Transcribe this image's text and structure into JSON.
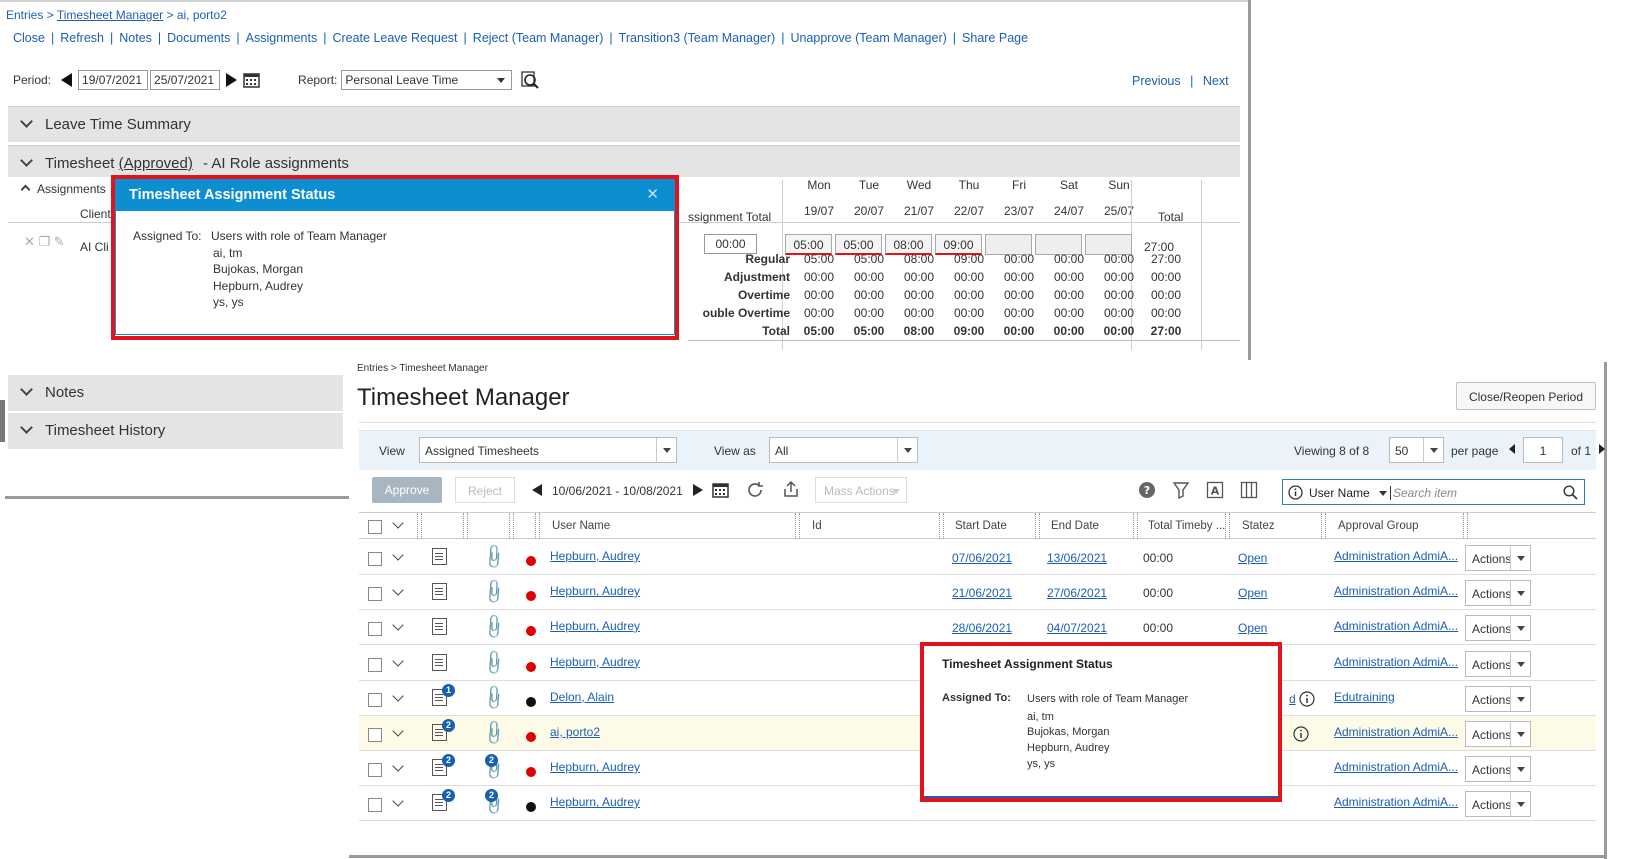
{
  "breadcrumb": {
    "entries": "Entries",
    "sep": ">",
    "manager": "Timesheet Manager",
    "current": "ai, porto2"
  },
  "actions": [
    "Close",
    "Refresh",
    "Notes",
    "Documents",
    "Assignments",
    "Create Leave Request",
    "Reject (Team Manager)",
    "Transition3 (Team Manager)",
    "Unapprove (Team Manager)",
    "Share Page"
  ],
  "period": {
    "label": "Period:",
    "start": "19/07/2021",
    "end": "25/07/2021",
    "report_label": "Report:",
    "report_value": "Personal Leave Time"
  },
  "pager": {
    "previous": "Previous",
    "next": "Next",
    "sep": "|"
  },
  "sections": {
    "leave_summary": "Leave Time Summary",
    "timesheet_prefix": "Timesheet",
    "timesheet_status": "(Approved)",
    "timesheet_suffix": "- AI Role assignments",
    "assignments": "Assignments",
    "client": "Client",
    "client_value": "AI Cli",
    "notes": "Notes",
    "history": "Timesheet History"
  },
  "grid": {
    "assignment_total": "ssignment Total",
    "total": "Total",
    "days": [
      {
        "day": "Mon",
        "date": "19/07"
      },
      {
        "day": "Tue",
        "date": "20/07"
      },
      {
        "day": "Wed",
        "date": "21/07"
      },
      {
        "day": "Thu",
        "date": "22/07"
      },
      {
        "day": "Fri",
        "date": "23/07"
      },
      {
        "day": "Sat",
        "date": "24/07"
      },
      {
        "day": "Sun",
        "date": "25/07"
      }
    ],
    "entry_total": "00:00",
    "entries": [
      "05:00",
      "05:00",
      "08:00",
      "09:00",
      "",
      "",
      ""
    ],
    "entries_total": "27:00",
    "rows": [
      {
        "label": "Regular",
        "values": [
          "05:00",
          "05:00",
          "08:00",
          "09:00",
          "00:00",
          "00:00",
          "00:00"
        ],
        "total": "27:00"
      },
      {
        "label": "Adjustment",
        "values": [
          "00:00",
          "00:00",
          "00:00",
          "00:00",
          "00:00",
          "00:00",
          "00:00"
        ],
        "total": "00:00"
      },
      {
        "label": "Overtime",
        "values": [
          "00:00",
          "00:00",
          "00:00",
          "00:00",
          "00:00",
          "00:00",
          "00:00"
        ],
        "total": "00:00"
      },
      {
        "label": "ouble Overtime",
        "values": [
          "00:00",
          "00:00",
          "00:00",
          "00:00",
          "00:00",
          "00:00",
          "00:00"
        ],
        "total": "00:00"
      },
      {
        "label": "Total",
        "values": [
          "05:00",
          "05:00",
          "08:00",
          "09:00",
          "00:00",
          "00:00",
          "00:00"
        ],
        "total": "27:00"
      }
    ]
  },
  "popup": {
    "title": "Timesheet Assignment Status",
    "close": "✕",
    "assigned_label": "Assigned To:",
    "assigned": [
      "Users with role of Team Manager",
      "ai, tm",
      "Bujokas, Morgan",
      "Hepburn, Audrey",
      "ys, ys"
    ]
  },
  "manager": {
    "breadcrumb": "Entries > Timesheet Manager",
    "title": "Timesheet Manager",
    "close_reopen": "Close/Reopen Period",
    "view_label": "View",
    "view_value": "Assigned Timesheets",
    "view_as_label": "View as",
    "view_as_value": "All",
    "viewing": "Viewing 8 of 8",
    "per_page_value": "50",
    "per_page_label": "per page",
    "page_value": "1",
    "of_pages": "of 1",
    "approve": "Approve",
    "reject": "Reject",
    "date_range": "10/06/2021 - 10/08/2021",
    "mass_actions": "Mass Actions",
    "search_field": "User Name",
    "search_placeholder": "Search item",
    "columns": [
      "User Name",
      "Id",
      "Start Date",
      "End Date",
      "Total Timeby ...",
      "Statez",
      "Approval Group"
    ],
    "rows": [
      {
        "user": "Hepburn, Audrey",
        "start": "07/06/2021",
        "end": "13/06/2021",
        "total": "00:00",
        "status": "Open",
        "group": "Administration AdmiA...",
        "dot": "red",
        "doc_badge": "",
        "clip_badge": "",
        "action": "Actions"
      },
      {
        "user": "Hepburn, Audrey",
        "start": "21/06/2021",
        "end": "27/06/2021",
        "total": "00:00",
        "status": "Open",
        "group": "Administration AdmiA...",
        "dot": "red",
        "doc_badge": "",
        "clip_badge": "",
        "action": "Actions"
      },
      {
        "user": "Hepburn, Audrey",
        "start": "28/06/2021",
        "end": "04/07/2021",
        "total": "00:00",
        "status": "Open",
        "group": "Administration AdmiA...",
        "dot": "red",
        "doc_badge": "",
        "clip_badge": "",
        "action": "Actions"
      },
      {
        "user": "Hepburn, Audrey",
        "start": "",
        "end": "",
        "total": "",
        "status": "",
        "group": "Administration AdmiA...",
        "dot": "red",
        "doc_badge": "",
        "clip_badge": "",
        "action": "Actions"
      },
      {
        "user": "Delon, Alain",
        "start": "",
        "end": "",
        "total": "",
        "status": "d",
        "group": "Edutraining",
        "dot": "black",
        "doc_badge": "1",
        "clip_badge": "",
        "action": "Actions"
      },
      {
        "user": "ai, porto2",
        "start": "",
        "end": "",
        "total": "",
        "status": "",
        "group": "Administration AdmiA...",
        "dot": "red",
        "doc_badge": "2",
        "clip_badge": "",
        "action": "Actions"
      },
      {
        "user": "Hepburn, Audrey",
        "start": "",
        "end": "",
        "total": "",
        "status": "",
        "group": "Administration AdmiA...",
        "dot": "red",
        "doc_badge": "2",
        "clip_badge": "2",
        "action": "Actions"
      },
      {
        "user": "Hepburn, Audrey",
        "start": "",
        "end": "",
        "total": "",
        "status": "",
        "group": "Administration AdmiA...",
        "dot": "black",
        "doc_badge": "2",
        "clip_badge": "2",
        "action": "Actions"
      }
    ]
  },
  "colors": {
    "accent": "#0d8ed1",
    "highlight": "#e3131b",
    "link": "#1a5fb4",
    "dot_red": "#e00000",
    "dot_black": "#111111"
  }
}
